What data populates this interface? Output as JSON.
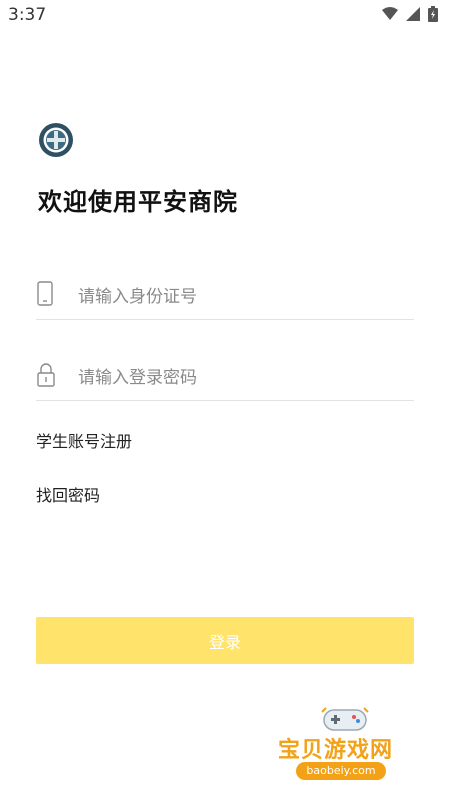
{
  "status_bar": {
    "time": "3:37"
  },
  "app": {
    "welcome": "欢迎使用平安商院"
  },
  "form": {
    "id_placeholder": "请输入身份证号",
    "password_placeholder": "请输入登录密码",
    "register_link": "学生账号注册",
    "forgot_link": "找回密码",
    "login_button": "登录"
  },
  "watermark": {
    "name": "宝贝游戏网",
    "url": "baobeiy.com"
  },
  "colors": {
    "accent": "#ffe36b",
    "watermark": "#f3a218"
  },
  "icons": [
    "wifi-icon",
    "signal-icon",
    "battery-icon",
    "phone-icon",
    "lock-icon",
    "school-logo",
    "gamepad-icon"
  ]
}
